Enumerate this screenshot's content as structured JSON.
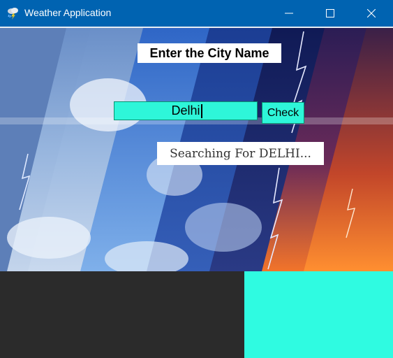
{
  "window": {
    "title": "Weather Application",
    "app_icon": "storm-cloud-icon",
    "controls": [
      "minimize-icon",
      "maximize-icon",
      "close-icon"
    ]
  },
  "form": {
    "city_label": "Enter the City Name",
    "city_value": "Delhi",
    "check_label": "Check",
    "status_text": "Searching For DELHI..."
  },
  "colors": {
    "titlebar": "#0063b1",
    "accent_cyan": "#2ef6d9",
    "panel_dark": "#2b2b2b",
    "panel_cyan": "#2ffbe1"
  }
}
